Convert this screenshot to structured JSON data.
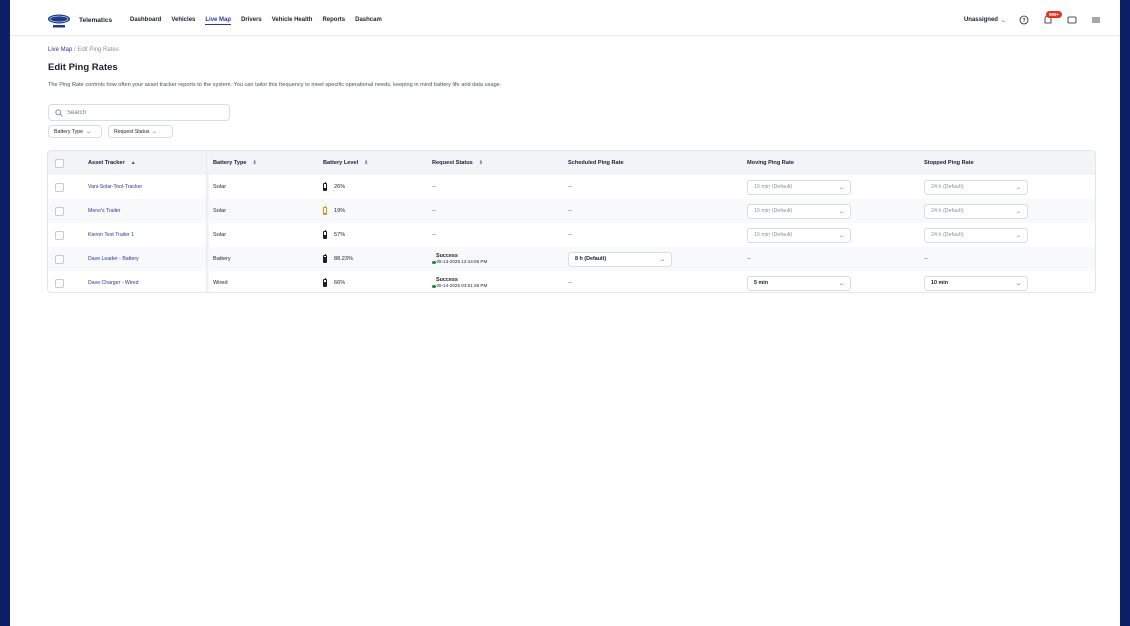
{
  "nav": {
    "brand": "Telematics",
    "items": [
      {
        "label": "Dashboard",
        "active": false
      },
      {
        "label": "Vehicles",
        "active": false
      },
      {
        "label": "Live Map",
        "active": true
      },
      {
        "label": "Drivers",
        "active": false
      },
      {
        "label": "Vehicle Health",
        "active": false
      },
      {
        "label": "Reports",
        "active": false
      },
      {
        "label": "Dashcam",
        "active": false
      }
    ],
    "assignment": "Unassigned",
    "notifications_badge": "999+"
  },
  "breadcrumb": {
    "parent": "Live Map",
    "separator": "/",
    "current": "Edit Ping Rates"
  },
  "page": {
    "title": "Edit Ping Rates",
    "description": "The Ping Rate controls how often your asset tracker reports to the system. You can tailor this frequency to meet specific operational needs, keeping in mind battery life and data usage."
  },
  "search": {
    "placeholder": "Search"
  },
  "filters": [
    "Battery Type",
    "Request Status"
  ],
  "table": {
    "headers": {
      "tracker": "Asset Tracker",
      "battery_type": "Battery Type",
      "battery_level": "Battery Level",
      "request_status": "Request Status",
      "scheduled": "Scheduled Ping Rate",
      "moving": "Moving Ping Rate",
      "stopped": "Stopped Ping Rate"
    },
    "sort_asc": "▲",
    "sort_both": "⇕",
    "rows": [
      {
        "tracker": "Vani-Solar-Tool-Tracker",
        "battery_type": "Solar",
        "battery_level": "26%",
        "level": 0.26,
        "warn": false,
        "status_title": "",
        "status_time": "",
        "status_dash": "--",
        "scheduled": "--",
        "moving": "15 min (Default)",
        "stopped": "24 h (Default)"
      },
      {
        "tracker": "Meno's Trailer",
        "battery_type": "Solar",
        "battery_level": "19%",
        "level": 0.19,
        "warn": true,
        "status_title": "",
        "status_time": "",
        "status_dash": "--",
        "scheduled": "--",
        "moving": "15 min (Default)",
        "stopped": "24 h (Default)"
      },
      {
        "tracker": "Kieron Test Trailer 1",
        "battery_type": "Solar",
        "battery_level": "57%",
        "level": 0.57,
        "warn": false,
        "status_title": "",
        "status_time": "",
        "status_dash": "--",
        "scheduled": "--",
        "moving": "15 min (Default)",
        "stopped": "24 h (Default)"
      },
      {
        "tracker": "Dave Loader - Battery",
        "battery_type": "Battery",
        "battery_level": "88.23%",
        "level": 0.88,
        "warn": false,
        "status_title": "Success",
        "status_time": "05-13-2025 12:44:06 PM",
        "status_dash": "",
        "scheduled": "8 h (Default)",
        "moving": "--",
        "stopped": "--"
      },
      {
        "tracker": "Dave Charger - Wired",
        "battery_type": "Wired",
        "battery_level": "66%",
        "level": 0.66,
        "warn": false,
        "status_title": "Success",
        "status_time": "05-14-2025 03:51:36 PM",
        "status_dash": "",
        "scheduled": "--",
        "moving": "5 min",
        "stopped": "10 min"
      }
    ]
  }
}
